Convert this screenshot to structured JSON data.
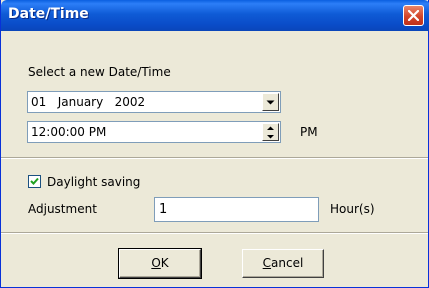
{
  "window": {
    "title": "Date/Time"
  },
  "prompt_label": "Select a new Date/Time",
  "date_combo": {
    "value": "01   January   2002"
  },
  "time_spin": {
    "value": "12:00:00 PM",
    "ampm_label": "PM"
  },
  "daylight": {
    "label": "Daylight saving",
    "checked": true
  },
  "adjustment": {
    "label": "Adjustment",
    "value": "1",
    "unit": "Hour(s)"
  },
  "buttons": {
    "ok_underline": "O",
    "ok_rest": "K",
    "cancel_underline": "C",
    "cancel_rest": "ancel"
  },
  "colors": {
    "titlebar": "#0a5fe0",
    "close_button": "#d3452a",
    "dialog_bg": "#ece9d8"
  },
  "icons": [
    "close-icon",
    "chevron-down-icon",
    "spin-up-icon",
    "spin-down-icon",
    "checkmark-icon"
  ]
}
